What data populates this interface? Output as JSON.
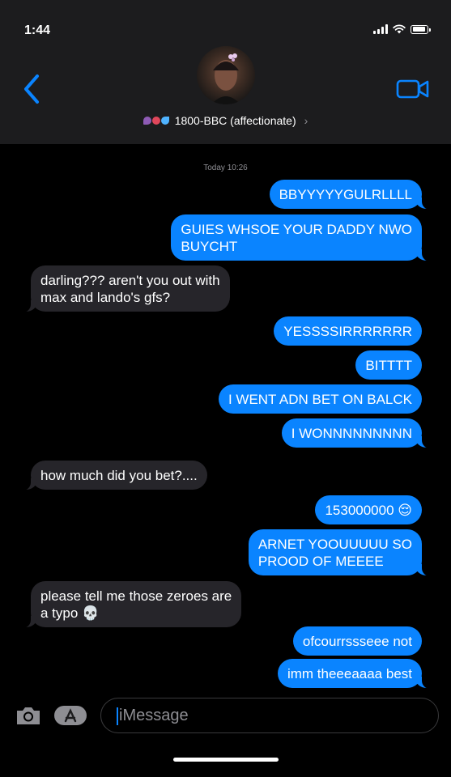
{
  "status": {
    "time": "1:44"
  },
  "header": {
    "contact_name": "1800-BBC (affectionate)",
    "emoji_prefix": [
      "eggplant",
      "lips",
      "sweat-droplets"
    ]
  },
  "conversation": {
    "timestamp": "Today 10:26",
    "messages": [
      {
        "from": "me",
        "text": "BBYYYYYGULRLLLL"
      },
      {
        "from": "me",
        "text": "GUIES WHSOE YOUR DADDY NWO\nBUYCHT"
      },
      {
        "from": "them",
        "text": "darling??? aren't you out with\nmax and lando's gfs?"
      },
      {
        "from": "me",
        "text": "YESSSSIRRRRRRR"
      },
      {
        "from": "me",
        "text": "BITTTT"
      },
      {
        "from": "me",
        "text": "I WENT ADN BET ON BALCK"
      },
      {
        "from": "me",
        "text": "I WONNNNNNNNN"
      },
      {
        "from": "them",
        "text": "how much did you bet?...."
      },
      {
        "from": "me",
        "text": "153000000 😌"
      },
      {
        "from": "me",
        "text": "ARNET YOOUUUUU SO\nPROOD OF MEEEE"
      },
      {
        "from": "them",
        "text": "please tell me those zeroes are\na typo 💀"
      },
      {
        "from": "me",
        "text": "ofcourrssseee not"
      },
      {
        "from": "me",
        "text": "imm theeeaaaa best"
      }
    ]
  },
  "composer": {
    "placeholder": "iMessage"
  },
  "colors": {
    "accent": "#0a84ff",
    "received": "#26252a",
    "header": "#1c1c1e"
  }
}
